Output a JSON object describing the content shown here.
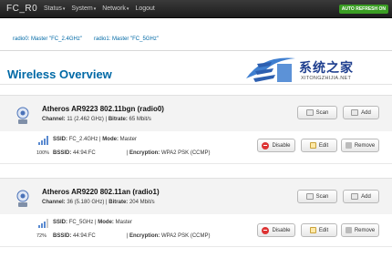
{
  "header": {
    "brand": "FC_R0",
    "nav": [
      {
        "label": "Status",
        "has_menu": true
      },
      {
        "label": "System",
        "has_menu": true
      },
      {
        "label": "Network",
        "has_menu": true
      },
      {
        "label": "Logout",
        "has_menu": false
      }
    ],
    "refresh_label": "AUTO REFRESH ON"
  },
  "tabs": [
    {
      "label": "radio0: Master \"FC_2.4GHz\""
    },
    {
      "label": "radio1: Master \"FC_5GHz\""
    }
  ],
  "page_title": "Wireless Overview",
  "watermark": {
    "cn": "系统之家",
    "en": "XITONGZHIJIA.NET"
  },
  "devices": [
    {
      "name": "Atheros AR9223 802.11bgn (radio0)",
      "channel_label": "Channel:",
      "channel_value": "11 (2.462 GHz)",
      "bitrate_label": "Bitrate:",
      "bitrate_value": "65 Mbit/s",
      "scan_label": "Scan",
      "add_label": "Add",
      "network": {
        "signal": "100%",
        "ssid_label": "SSID:",
        "ssid_value": "FC_2.4GHz",
        "mode_label": "Mode:",
        "mode_value": "Master",
        "bssid_label": "BSSID:",
        "bssid_value": "44:94:FC",
        "enc_label": "Encryption:",
        "enc_value": "WPA2 PSK (CCMP)",
        "disable_label": "Disable",
        "edit_label": "Edit",
        "remove_label": "Remove"
      }
    },
    {
      "name": "Atheros AR9220 802.11an (radio1)",
      "channel_label": "Channel:",
      "channel_value": "36 (5.180 GHz)",
      "bitrate_label": "Bitrate:",
      "bitrate_value": "204 Mbit/s",
      "scan_label": "Scan",
      "add_label": "Add",
      "network": {
        "signal": "72%",
        "ssid_label": "SSID:",
        "ssid_value": "FC_5GHz",
        "mode_label": "Mode:",
        "mode_value": "Master",
        "bssid_label": "BSSID:",
        "bssid_value": "44:94:FC",
        "enc_label": "Encryption:",
        "enc_value": "WPA2 PSK (CCMP)",
        "disable_label": "Disable",
        "edit_label": "Edit",
        "remove_label": "Remove"
      }
    }
  ]
}
